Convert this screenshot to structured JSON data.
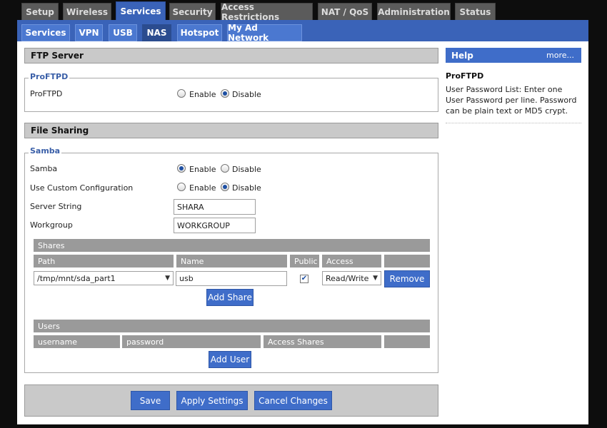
{
  "top_tabs": [
    "Setup",
    "Wireless",
    "Services",
    "Security",
    "Access Restrictions",
    "NAT / QoS",
    "Administration",
    "Status"
  ],
  "sub_tabs": [
    "Services",
    "VPN",
    "USB",
    "NAS",
    "Hotspot",
    "My Ad Network"
  ],
  "ftp": {
    "header": "FTP Server",
    "legend": "ProFTPD",
    "label": "ProFTPD",
    "enable": "Enable",
    "disable": "Disable",
    "selected": "Disable"
  },
  "file_sharing": {
    "header": "File Sharing",
    "legend": "Samba",
    "samba_label": "Samba",
    "samba_selected": "Enable",
    "custom_label": "Use Custom Configuration",
    "custom_selected": "Disable",
    "enable": "Enable",
    "disable": "Disable",
    "server_string_label": "Server String",
    "server_string_value": "SHARA",
    "workgroup_label": "Workgroup",
    "workgroup_value": "WORKGROUP",
    "shares": {
      "title": "Shares",
      "headers": [
        "Path",
        "Name",
        "Public",
        "Access"
      ],
      "row": {
        "path": "/tmp/mnt/sda_part1",
        "name": "usb",
        "public": true,
        "access": "Read/Write",
        "remove": "Remove"
      },
      "add": "Add Share"
    },
    "users": {
      "title": "Users",
      "headers": [
        "username",
        "password",
        "Access Shares"
      ],
      "add": "Add User"
    }
  },
  "buttons": {
    "save": "Save",
    "apply": "Apply Settings",
    "cancel": "Cancel Changes"
  },
  "help": {
    "title": "Help",
    "more": "more...",
    "topic": "ProFTPD",
    "text": "User Password List: Enter one User Password per line. Password can be plain text or MD5 crypt."
  }
}
